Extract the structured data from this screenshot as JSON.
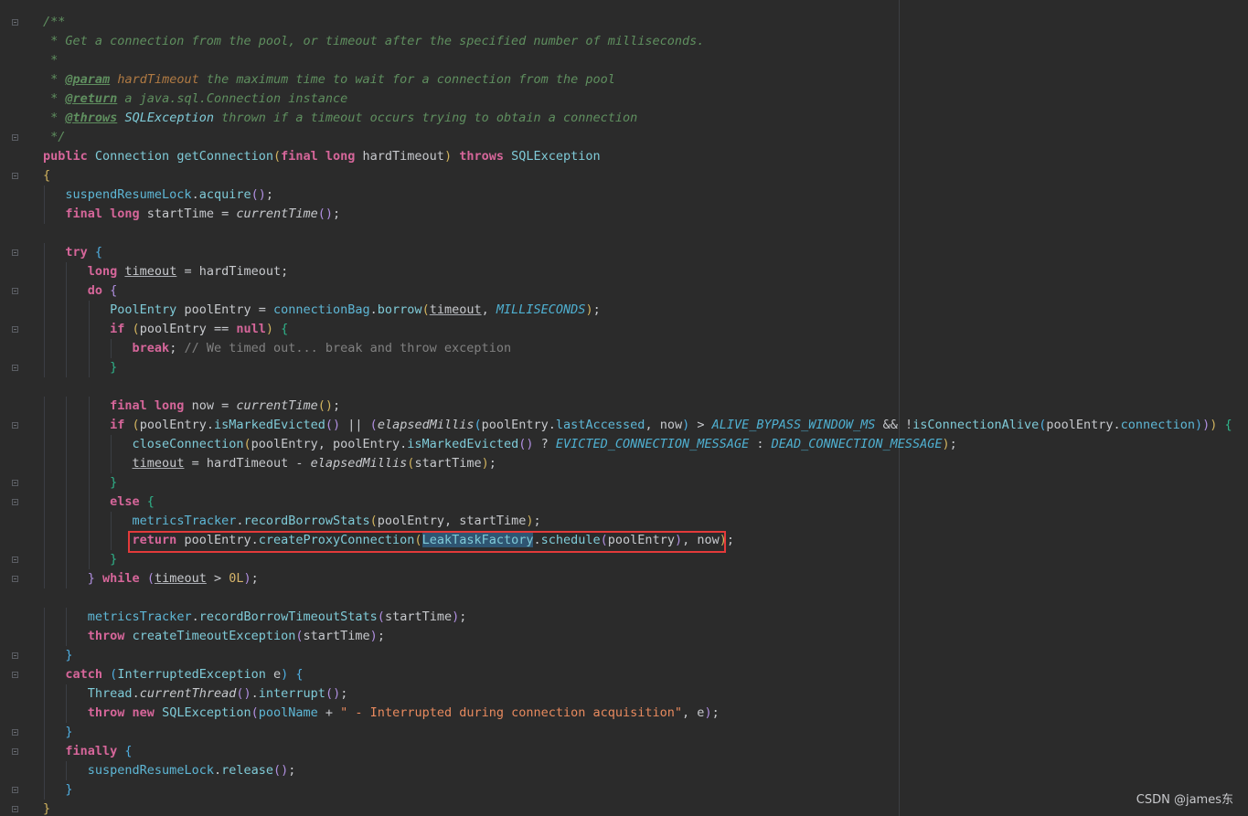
{
  "editor": {
    "lines": [
      [
        [
          "doc",
          "/**"
        ]
      ],
      [
        [
          "doc",
          " * Get a connection from the pool, or timeout after the specified number of milliseconds."
        ]
      ],
      [
        [
          "doc",
          " *"
        ]
      ],
      [
        [
          "doc",
          " * "
        ],
        [
          "doctag",
          "@param"
        ],
        [
          "doc",
          " "
        ],
        [
          "docparam",
          "hardTimeout"
        ],
        [
          "doc",
          " the maximum time to wait for a connection from the pool"
        ]
      ],
      [
        [
          "doc",
          " * "
        ],
        [
          "doctag",
          "@return"
        ],
        [
          "doc",
          " a java.sql.Connection instance"
        ]
      ],
      [
        [
          "doc",
          " * "
        ],
        [
          "doctag",
          "@throws"
        ],
        [
          "doc",
          " "
        ],
        [
          "doclink",
          "SQLException"
        ],
        [
          "doc",
          " thrown if a timeout occurs trying to obtain a connection"
        ]
      ],
      [
        [
          "doc",
          " */"
        ]
      ],
      [
        [
          "kw",
          "public "
        ],
        [
          "type",
          "Connection "
        ],
        [
          "fn",
          "getConnection"
        ],
        [
          "p1",
          "("
        ],
        [
          "kw",
          "final long "
        ],
        [
          "tk",
          "hardTimeout"
        ],
        [
          "p1",
          ")"
        ],
        [
          "kw",
          " throws "
        ],
        [
          "type",
          "SQLException"
        ]
      ],
      [
        [
          "p1",
          "{"
        ]
      ],
      [
        [
          "tk",
          "   "
        ],
        [
          "field",
          "suspendResumeLock"
        ],
        [
          "tk",
          "."
        ],
        [
          "fn",
          "acquire"
        ],
        [
          "p2",
          "()"
        ],
        [
          "tk",
          ";"
        ]
      ],
      [
        [
          "tk",
          "   "
        ],
        [
          "kw",
          "final long "
        ],
        [
          "tk",
          "startTime = "
        ],
        [
          "it",
          "currentTime"
        ],
        [
          "p2",
          "()"
        ],
        [
          "tk",
          ";"
        ]
      ],
      [
        [
          "tk",
          ""
        ]
      ],
      [
        [
          "tk",
          "   "
        ],
        [
          "kw",
          "try "
        ],
        [
          "p3",
          "{"
        ]
      ],
      [
        [
          "tk",
          "      "
        ],
        [
          "kw",
          "long "
        ],
        [
          "ul",
          "timeout"
        ],
        [
          "tk",
          " = hardTimeout;"
        ]
      ],
      [
        [
          "tk",
          "      "
        ],
        [
          "kw",
          "do "
        ],
        [
          "p2",
          "{"
        ]
      ],
      [
        [
          "tk",
          "         "
        ],
        [
          "type",
          "PoolEntry "
        ],
        [
          "tk",
          "poolEntry = "
        ],
        [
          "field",
          "connectionBag"
        ],
        [
          "tk",
          "."
        ],
        [
          "fn",
          "borrow"
        ],
        [
          "p1",
          "("
        ],
        [
          "ul",
          "timeout"
        ],
        [
          "tk",
          ", "
        ],
        [
          "const",
          "MILLISECONDS"
        ],
        [
          "p1",
          ")"
        ],
        [
          "tk",
          ";"
        ]
      ],
      [
        [
          "tk",
          "         "
        ],
        [
          "kw",
          "if "
        ],
        [
          "p1",
          "("
        ],
        [
          "tk",
          "poolEntry == "
        ],
        [
          "kw",
          "null"
        ],
        [
          "p1",
          ")"
        ],
        [
          "tk",
          " "
        ],
        [
          "brc",
          "{"
        ]
      ],
      [
        [
          "tk",
          "            "
        ],
        [
          "kw",
          "break"
        ],
        [
          "tk",
          "; "
        ],
        [
          "cmt",
          "// We timed out... break and throw exception"
        ]
      ],
      [
        [
          "tk",
          "         "
        ],
        [
          "brc",
          "}"
        ]
      ],
      [
        [
          "tk",
          ""
        ]
      ],
      [
        [
          "tk",
          "         "
        ],
        [
          "kw",
          "final long "
        ],
        [
          "tk",
          "now = "
        ],
        [
          "it",
          "currentTime"
        ],
        [
          "p1",
          "()"
        ],
        [
          "tk",
          ";"
        ]
      ],
      [
        [
          "tk",
          "         "
        ],
        [
          "kw",
          "if "
        ],
        [
          "p1",
          "("
        ],
        [
          "tk",
          "poolEntry."
        ],
        [
          "fn",
          "isMarkedEvicted"
        ],
        [
          "p2",
          "()"
        ],
        [
          "tk",
          " || "
        ],
        [
          "p2",
          "("
        ],
        [
          "it",
          "elapsedMillis"
        ],
        [
          "p3",
          "("
        ],
        [
          "tk",
          "poolEntry."
        ],
        [
          "field",
          "lastAccessed"
        ],
        [
          "tk",
          ", now"
        ],
        [
          "p3",
          ")"
        ],
        [
          "tk",
          " > "
        ],
        [
          "const",
          "ALIVE_BYPASS_WINDOW_MS"
        ],
        [
          "tk",
          " && !"
        ],
        [
          "fn",
          "isConnectionAlive"
        ],
        [
          "p3",
          "("
        ],
        [
          "tk",
          "poolEntry."
        ],
        [
          "field",
          "connection"
        ],
        [
          "p3",
          ")"
        ],
        [
          "p2",
          ")"
        ],
        [
          "p1",
          ")"
        ],
        [
          "tk",
          " "
        ],
        [
          "brc",
          "{"
        ]
      ],
      [
        [
          "tk",
          "            "
        ],
        [
          "fn",
          "closeConnection"
        ],
        [
          "p1",
          "("
        ],
        [
          "tk",
          "poolEntry, poolEntry."
        ],
        [
          "fn",
          "isMarkedEvicted"
        ],
        [
          "p2",
          "()"
        ],
        [
          "tk",
          " ? "
        ],
        [
          "const",
          "EVICTED_CONNECTION_MESSAGE"
        ],
        [
          "tk",
          " : "
        ],
        [
          "const",
          "DEAD_CONNECTION_MESSAGE"
        ],
        [
          "p1",
          ")"
        ],
        [
          "tk",
          ";"
        ]
      ],
      [
        [
          "tk",
          "            "
        ],
        [
          "ul",
          "timeout"
        ],
        [
          "tk",
          " = hardTimeout - "
        ],
        [
          "it",
          "elapsedMillis"
        ],
        [
          "p1",
          "("
        ],
        [
          "tk",
          "startTime"
        ],
        [
          "p1",
          ")"
        ],
        [
          "tk",
          ";"
        ]
      ],
      [
        [
          "tk",
          "         "
        ],
        [
          "brc",
          "}"
        ]
      ],
      [
        [
          "tk",
          "         "
        ],
        [
          "kw",
          "else "
        ],
        [
          "brc",
          "{"
        ]
      ],
      [
        [
          "tk",
          "            "
        ],
        [
          "field",
          "metricsTracker"
        ],
        [
          "tk",
          "."
        ],
        [
          "fn",
          "recordBorrowStats"
        ],
        [
          "p1",
          "("
        ],
        [
          "tk",
          "poolEntry, startTime"
        ],
        [
          "p1",
          ")"
        ],
        [
          "tk",
          ";"
        ]
      ],
      [
        [
          "tk",
          "            "
        ],
        [
          "kw",
          "return "
        ],
        [
          "tk",
          "poolEntry."
        ],
        [
          "fn",
          "createProxyConnection"
        ],
        [
          "p1",
          "("
        ],
        [
          "sel",
          "LeakTaskFactory"
        ],
        [
          "tk",
          "."
        ],
        [
          "fn",
          "schedule"
        ],
        [
          "p2",
          "("
        ],
        [
          "tk",
          "poolEntry"
        ],
        [
          "p2",
          ")"
        ],
        [
          "tk",
          ", now"
        ],
        [
          "p1",
          ")"
        ],
        [
          "tk",
          ";"
        ]
      ],
      [
        [
          "tk",
          "         "
        ],
        [
          "brc",
          "}"
        ]
      ],
      [
        [
          "tk",
          "      "
        ],
        [
          "p2",
          "}"
        ],
        [
          "kw",
          " while "
        ],
        [
          "p2",
          "("
        ],
        [
          "ul",
          "timeout"
        ],
        [
          "tk",
          " > "
        ],
        [
          "num",
          "0L"
        ],
        [
          "p2",
          ")"
        ],
        [
          "tk",
          ";"
        ]
      ],
      [
        [
          "tk",
          ""
        ]
      ],
      [
        [
          "tk",
          "      "
        ],
        [
          "field",
          "metricsTracker"
        ],
        [
          "tk",
          "."
        ],
        [
          "fn",
          "recordBorrowTimeoutStats"
        ],
        [
          "p2",
          "("
        ],
        [
          "tk",
          "startTime"
        ],
        [
          "p2",
          ")"
        ],
        [
          "tk",
          ";"
        ]
      ],
      [
        [
          "tk",
          "      "
        ],
        [
          "kw",
          "throw "
        ],
        [
          "fn",
          "createTimeoutException"
        ],
        [
          "p2",
          "("
        ],
        [
          "tk",
          "startTime"
        ],
        [
          "p2",
          ")"
        ],
        [
          "tk",
          ";"
        ]
      ],
      [
        [
          "tk",
          "   "
        ],
        [
          "p3",
          "}"
        ]
      ],
      [
        [
          "tk",
          "   "
        ],
        [
          "kw",
          "catch "
        ],
        [
          "p3",
          "("
        ],
        [
          "type",
          "InterruptedException "
        ],
        [
          "tk",
          "e"
        ],
        [
          "p3",
          ")"
        ],
        [
          "tk",
          " "
        ],
        [
          "p3",
          "{"
        ]
      ],
      [
        [
          "tk",
          "      "
        ],
        [
          "type",
          "Thread"
        ],
        [
          "tk",
          "."
        ],
        [
          "it",
          "currentThread"
        ],
        [
          "p2",
          "()"
        ],
        [
          "tk",
          "."
        ],
        [
          "fn",
          "interrupt"
        ],
        [
          "p2",
          "()"
        ],
        [
          "tk",
          ";"
        ]
      ],
      [
        [
          "tk",
          "      "
        ],
        [
          "kw",
          "throw new "
        ],
        [
          "type",
          "SQLException"
        ],
        [
          "p2",
          "("
        ],
        [
          "field",
          "poolName"
        ],
        [
          "tk",
          " + "
        ],
        [
          "str",
          "\" - Interrupted during connection acquisition\""
        ],
        [
          "tk",
          ", e"
        ],
        [
          "p2",
          ")"
        ],
        [
          "tk",
          ";"
        ]
      ],
      [
        [
          "tk",
          "   "
        ],
        [
          "p3",
          "}"
        ]
      ],
      [
        [
          "tk",
          "   "
        ],
        [
          "kw",
          "finally "
        ],
        [
          "p3",
          "{"
        ]
      ],
      [
        [
          "tk",
          "      "
        ],
        [
          "field",
          "suspendResumeLock"
        ],
        [
          "tk",
          "."
        ],
        [
          "fn",
          "release"
        ],
        [
          "p2",
          "()"
        ],
        [
          "tk",
          ";"
        ]
      ],
      [
        [
          "tk",
          "   "
        ],
        [
          "p3",
          "}"
        ]
      ],
      [
        [
          "p1",
          "}"
        ]
      ]
    ],
    "fold_lines": [
      0,
      6,
      8,
      12,
      14,
      16,
      18,
      21,
      24,
      25,
      28,
      29,
      33,
      34,
      37,
      38,
      40,
      41
    ]
  },
  "watermark": "CSDN @james东"
}
